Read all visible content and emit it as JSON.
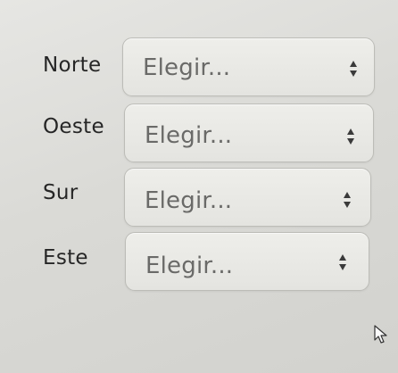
{
  "fields": [
    {
      "label": "Norte",
      "value": "Elegir..."
    },
    {
      "label": "Oeste",
      "value": "Elegir..."
    },
    {
      "label": "Sur",
      "value": "Elegir..."
    },
    {
      "label": "Este",
      "value": "Elegir..."
    }
  ],
  "icons": {
    "select_arrows": "up-down-arrows-icon",
    "cursor": "mouse-pointer-icon"
  },
  "colors": {
    "background": "#dedeDA",
    "select_border": "#bcbcb7",
    "label_text": "#262626",
    "placeholder_text": "#6a6a68"
  }
}
